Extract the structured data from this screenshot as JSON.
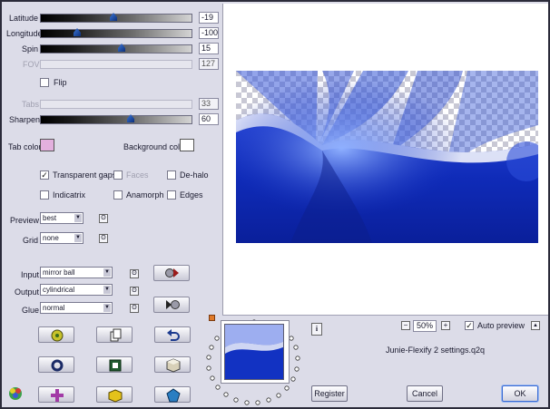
{
  "controls": {
    "latitude": {
      "label": "Latitude",
      "value": "-19",
      "level": 0.48
    },
    "longitude": {
      "label": "Longitude",
      "value": "-100",
      "level": 0.23
    },
    "spin": {
      "label": "Spin",
      "value": "15",
      "level": 0.54
    },
    "fov": {
      "label": "FOV",
      "value": "127"
    },
    "flip": {
      "label": "Flip",
      "checked": false
    },
    "tabs": {
      "label": "Tabs",
      "value": "33"
    },
    "sharpen": {
      "label": "Sharpen",
      "value": "60",
      "level": 0.6
    }
  },
  "colors": {
    "tab_color_label": "Tab color",
    "tab_color": "#e3b0de",
    "background_color_label": "Background color",
    "background_color": "#ffffff"
  },
  "options": {
    "transparent_gaps": {
      "label": "Transparent gaps",
      "checked": true
    },
    "faces": {
      "label": "Faces",
      "checked": false
    },
    "de_halo": {
      "label": "De-halo",
      "checked": false
    },
    "indicatrix": {
      "label": "Indicatrix",
      "checked": false
    },
    "anamorph": {
      "label": "Anamorph",
      "checked": false
    },
    "edges": {
      "label": "Edges",
      "checked": false
    }
  },
  "preview_settings": {
    "preview_label": "Preview",
    "preview_value": "best",
    "grid_label": "Grid",
    "grid_value": "none"
  },
  "mapping": {
    "input_label": "Input",
    "input_value": "mirror ball",
    "output_label": "Output",
    "output_value": "cylindrical",
    "glue_label": "Glue",
    "glue_value": "normal"
  },
  "bottom_bar": {
    "zoom": "50%",
    "zoom_minus": "−",
    "zoom_plus": "+",
    "auto_preview_label": "Auto preview",
    "auto_preview_checked": true,
    "settings_file": "Junie-Flexify 2 settings.q2q",
    "info": "i",
    "register_label": "Register",
    "cancel_label": "Cancel",
    "ok_label": "OK"
  }
}
